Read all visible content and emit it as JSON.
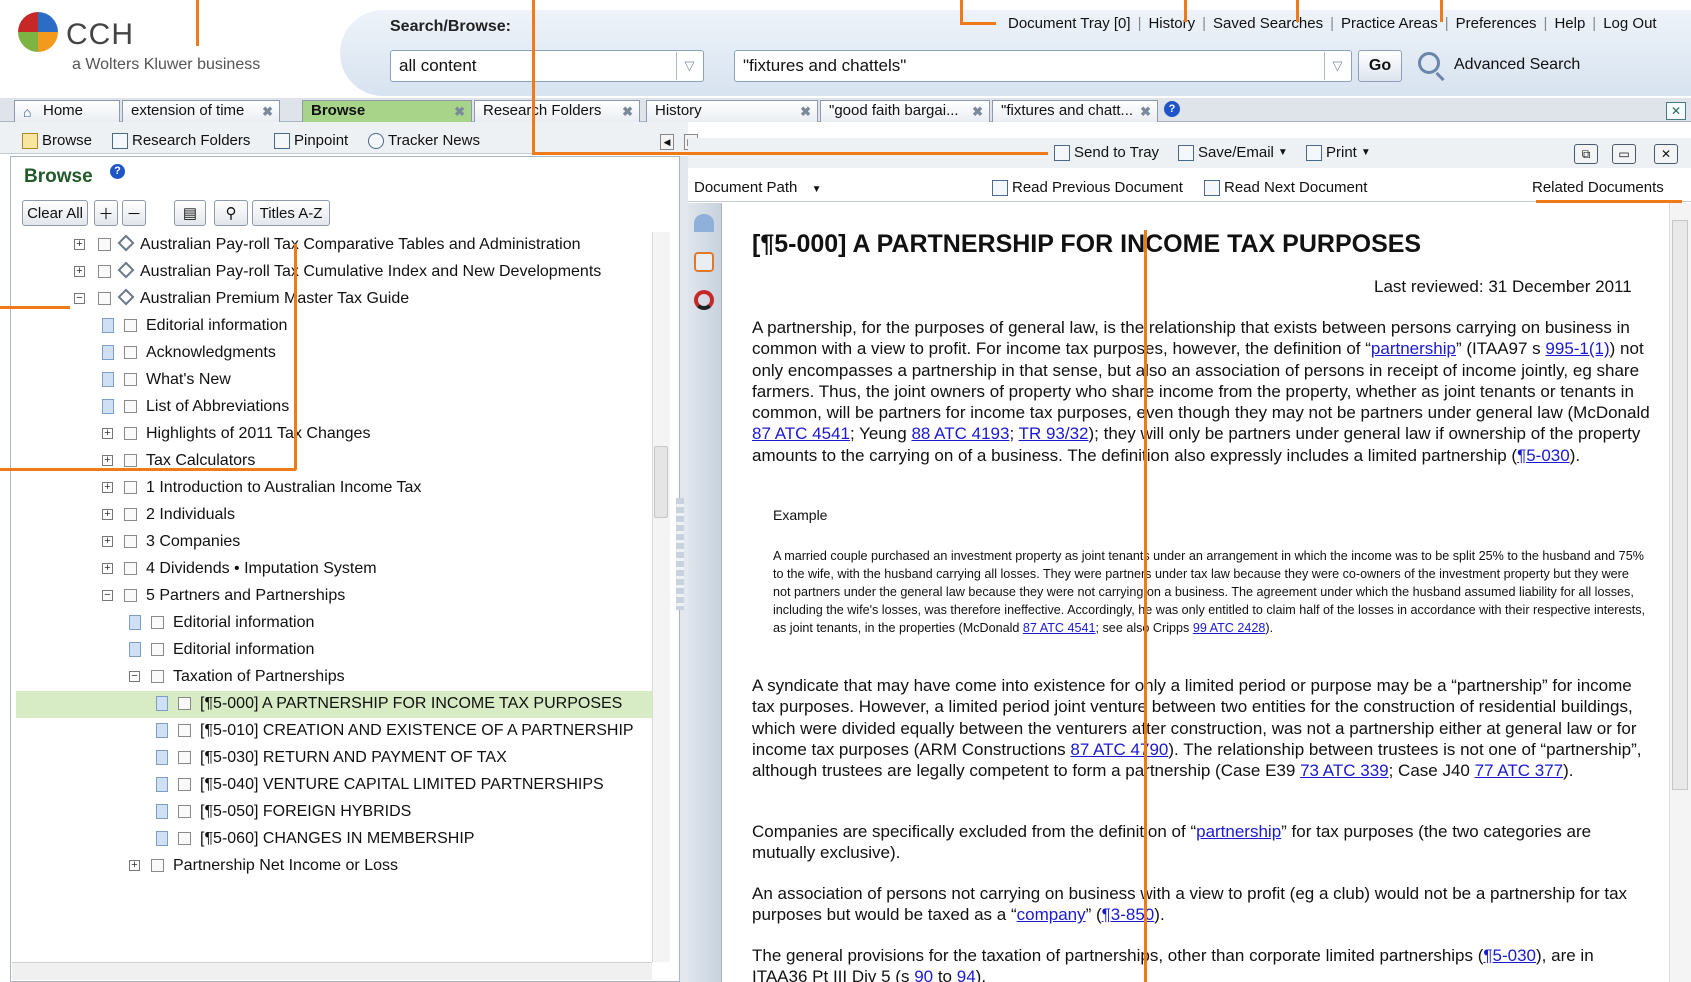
{
  "header": {
    "logo_text": "CCH",
    "logo_sub": "a Wolters Kluwer business",
    "search_label": "Search/Browse:",
    "scope_value": "all content",
    "query_value": "\"fixtures and chattels\"",
    "go_label": "Go",
    "advanced_search": "Advanced Search",
    "links": [
      "Document Tray [0]",
      "History",
      "Saved Searches",
      "Practice Areas",
      "Preferences",
      "Help",
      "Log Out"
    ]
  },
  "tabs": [
    {
      "label": "Home"
    },
    {
      "label": "extension of time"
    },
    {
      "label": "Browse"
    },
    {
      "label": "Research Folders"
    },
    {
      "label": "History"
    },
    {
      "label": "\"good faith bargai..."
    },
    {
      "label": "\"fixtures and chatt..."
    }
  ],
  "left_toolbar": [
    "Browse",
    "Research Folders",
    "Pinpoint",
    "Tracker News"
  ],
  "browse_panel": {
    "title": "Browse",
    "buttons": {
      "clear_all": "Clear All",
      "titles_az": "Titles A-Z"
    },
    "tree": [
      {
        "label": "Australian Pay-roll Tax Comparative Tables and Administration"
      },
      {
        "label": "Australian Pay-roll Tax Cumulative Index and New Developments"
      },
      {
        "label": "Australian Premium Master Tax Guide"
      },
      {
        "label": "Editorial information"
      },
      {
        "label": "Acknowledgments"
      },
      {
        "label": "What's New"
      },
      {
        "label": "List of Abbreviations"
      },
      {
        "label": "Highlights of 2011 Tax Changes"
      },
      {
        "label": "Tax Calculators"
      },
      {
        "label": "1 Introduction to Australian Income Tax"
      },
      {
        "label": "2 Individuals"
      },
      {
        "label": "3 Companies"
      },
      {
        "label": "4 Dividends • Imputation System"
      },
      {
        "label": "5 Partners and Partnerships"
      },
      {
        "label": "Editorial information"
      },
      {
        "label": "Editorial information"
      },
      {
        "label": "Taxation of Partnerships"
      },
      {
        "label": "[¶5-000] A PARTNERSHIP FOR INCOME TAX PURPOSES"
      },
      {
        "label": "[¶5-010] CREATION AND EXISTENCE OF A PARTNERSHIP"
      },
      {
        "label": "[¶5-030] RETURN AND PAYMENT OF TAX"
      },
      {
        "label": "[¶5-040] VENTURE CAPITAL LIMITED PARTNERSHIPS"
      },
      {
        "label": "[¶5-050] FOREIGN HYBRIDS"
      },
      {
        "label": "[¶5-060] CHANGES IN MEMBERSHIP"
      },
      {
        "label": "Partnership Net Income or Loss"
      }
    ]
  },
  "doc_toolbar": {
    "send_to_tray": "Send to Tray",
    "save_email": "Save/Email",
    "print": "Print"
  },
  "doc_nav": {
    "document_path": "Document Path",
    "read_previous": "Read Previous Document",
    "read_next": "Read Next Document",
    "related": "Related Documents"
  },
  "document": {
    "title": "[¶5-000] A PARTNERSHIP FOR INCOME TAX PURPOSES",
    "last_reviewed": "Last reviewed: 31 December 2011",
    "p1": {
      "t1": "A partnership, for the purposes of general law, is the relationship that exists between persons carrying on business in common with a view to profit. For income tax purposes, however, the definition of “",
      "l1": "partnership",
      "t2": "” (ITAA97 s ",
      "l2": "995-1(1)",
      "t3": ") not only encompasses a partnership in that sense, but also an association of persons in receipt of income jointly, eg share farmers. Thus, the joint owners of property who share income from the property, whether as joint tenants or tenants in common, will be partners for income tax purposes, even though they may not be partners under general law (McDonald ",
      "l3": "87 ATC 4541",
      "t4": "; Yeung ",
      "l4": "88 ATC 4193",
      "t5": "; ",
      "l5": "TR 93/32",
      "t6": "); they will only be partners under general law if ownership of the property amounts to the carrying on of a business. The definition also expressly includes a limited partnership (",
      "l6": "¶5-030",
      "t7": ")."
    },
    "example_label": "Example",
    "example": {
      "t1": "A married couple purchased an investment property as joint tenants under an arrangement in which the income was to be split 25% to the husband and 75% to the wife, with the husband carrying all losses. They were partners under tax law because they were co-owners of the investment property but they were not partners under the general law because they were not carrying on a business. The agreement under which the husband assumed liability for all losses, including the wife's losses, was therefore ineffective. Accordingly, he was only entitled to claim half of the losses in accordance with their respective interests, as joint tenants, in the properties (McDonald ",
      "l1": "87 ATC 4541",
      "t2": "; see also Cripps ",
      "l2": "99 ATC 2428",
      "t3": ")."
    },
    "p2": {
      "t1": "A syndicate that may have come into existence for only a limited period or purpose may be a “partnership” for income tax purposes. However, a limited period joint venture between two entities for the construction of residential buildings, which were divided equally between the venturers after construction, was not a partnership either at general law or for income tax purposes (ARM Constructions ",
      "l1": "87 ATC 4790",
      "t2": "). The relationship between trustees is not one of “partnership”, although trustees are legally competent to form a partnership (Case E39 ",
      "l2": "73 ATC 339",
      "t3": "; Case J40 ",
      "l3": "77 ATC 377",
      "t4": ")."
    },
    "p3": {
      "t1": "Companies are specifically excluded from the definition of “",
      "l1": "partnership",
      "t2": "” for tax purposes (the two categories are mutually exclusive)."
    },
    "p4": {
      "t1": "An association of persons not carrying on business with a view to profit (eg a club) would not be a partnership for tax purposes but would be taxed as a “",
      "l1": "company",
      "t2": "” (",
      "l2": "¶3-850",
      "t3": ")."
    },
    "p5": {
      "t1": "The general provisions for the taxation of partnerships, other than corporate limited partnerships (",
      "l1": "¶5-030",
      "t2": "), are in ITAA36 Pt III Div 5 (s ",
      "l2": "90",
      "t3": " to ",
      "l3": "94",
      "t4": ")."
    }
  },
  "colors": {
    "accent_orange": "#f07a18",
    "selected_row": "#d7ebc4",
    "active_tab": "#a8d48a",
    "link": "#1a1ad0"
  }
}
